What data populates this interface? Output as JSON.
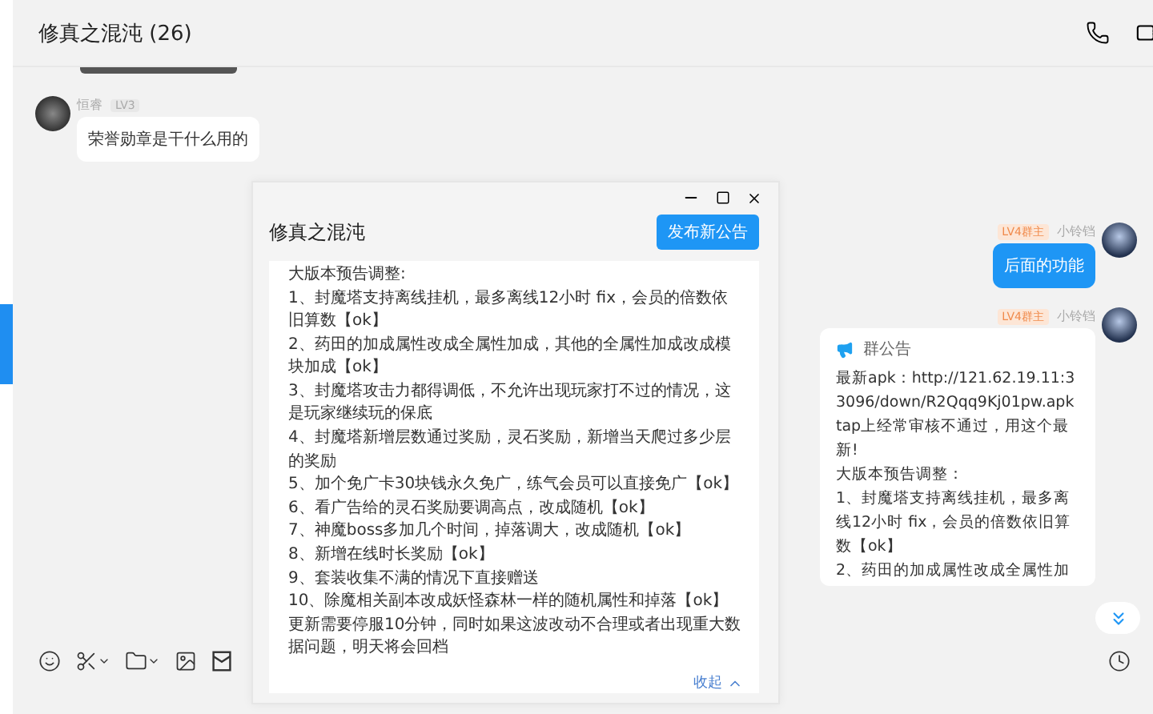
{
  "chat": {
    "title": "修真之混沌 (26)"
  },
  "messages": [
    {
      "kind": "text",
      "outgoing": false,
      "sender": "恒睿",
      "badge": "LV3",
      "text": "荣誉勋章是干什么用的"
    },
    {
      "kind": "text",
      "outgoing": true,
      "sender": "小铃铛",
      "badge": "LV4群主",
      "text": "后面的功能"
    },
    {
      "kind": "notice",
      "outgoing": true,
      "sender": "小铃铛",
      "badge": "LV4群主",
      "notice_title": "群公告",
      "lines": [
        "最新apk：http://121.62.19.11:33096/down/R2Qqq9Kj01pw.apk",
        "tap上经常审核不通过，用这个最新!",
        "大版本预告调整：",
        "1、封魔塔支持离线挂机，最多离线12小时 fix，会员的倍数依旧算数【ok】",
        "2、药田的加成属性改成全属性加"
      ]
    }
  ],
  "popup": {
    "title": "修真之混沌",
    "publish_button": "发布新公告",
    "collapse_link": "收起",
    "lines": [
      "大版本预告调整:",
      "1、封魔塔支持离线挂机，最多离线12小时 fix，会员的倍数依旧算数【ok】",
      "2、药田的加成属性改成全属性加成，其他的全属性加成改成模块加成【ok】",
      "3、封魔塔攻击力都得调低，不允许出现玩家打不过的情况，这是玩家继续玩的保底",
      "4、封魔塔新增层数通过奖励，灵石奖励，新增当天爬过多少层的奖励",
      "5、加个免广卡30块钱永久免广，练气会员可以直接免广【ok】",
      "6、看广告给的灵石奖励要调高点，改成随机【ok】",
      "7、神魔boss多加几个时间，掉落调大，改成随机【ok】",
      "8、新增在线时长奖励【ok】",
      "9、套装收集不满的情况下直接赠送",
      "10、除魔相关副本改成妖怪森林一样的随机属性和掉落【ok】",
      "更新需要停服10分钟，同时如果这波改动不合理或者出现重大数据问题，明天将会回档"
    ]
  }
}
